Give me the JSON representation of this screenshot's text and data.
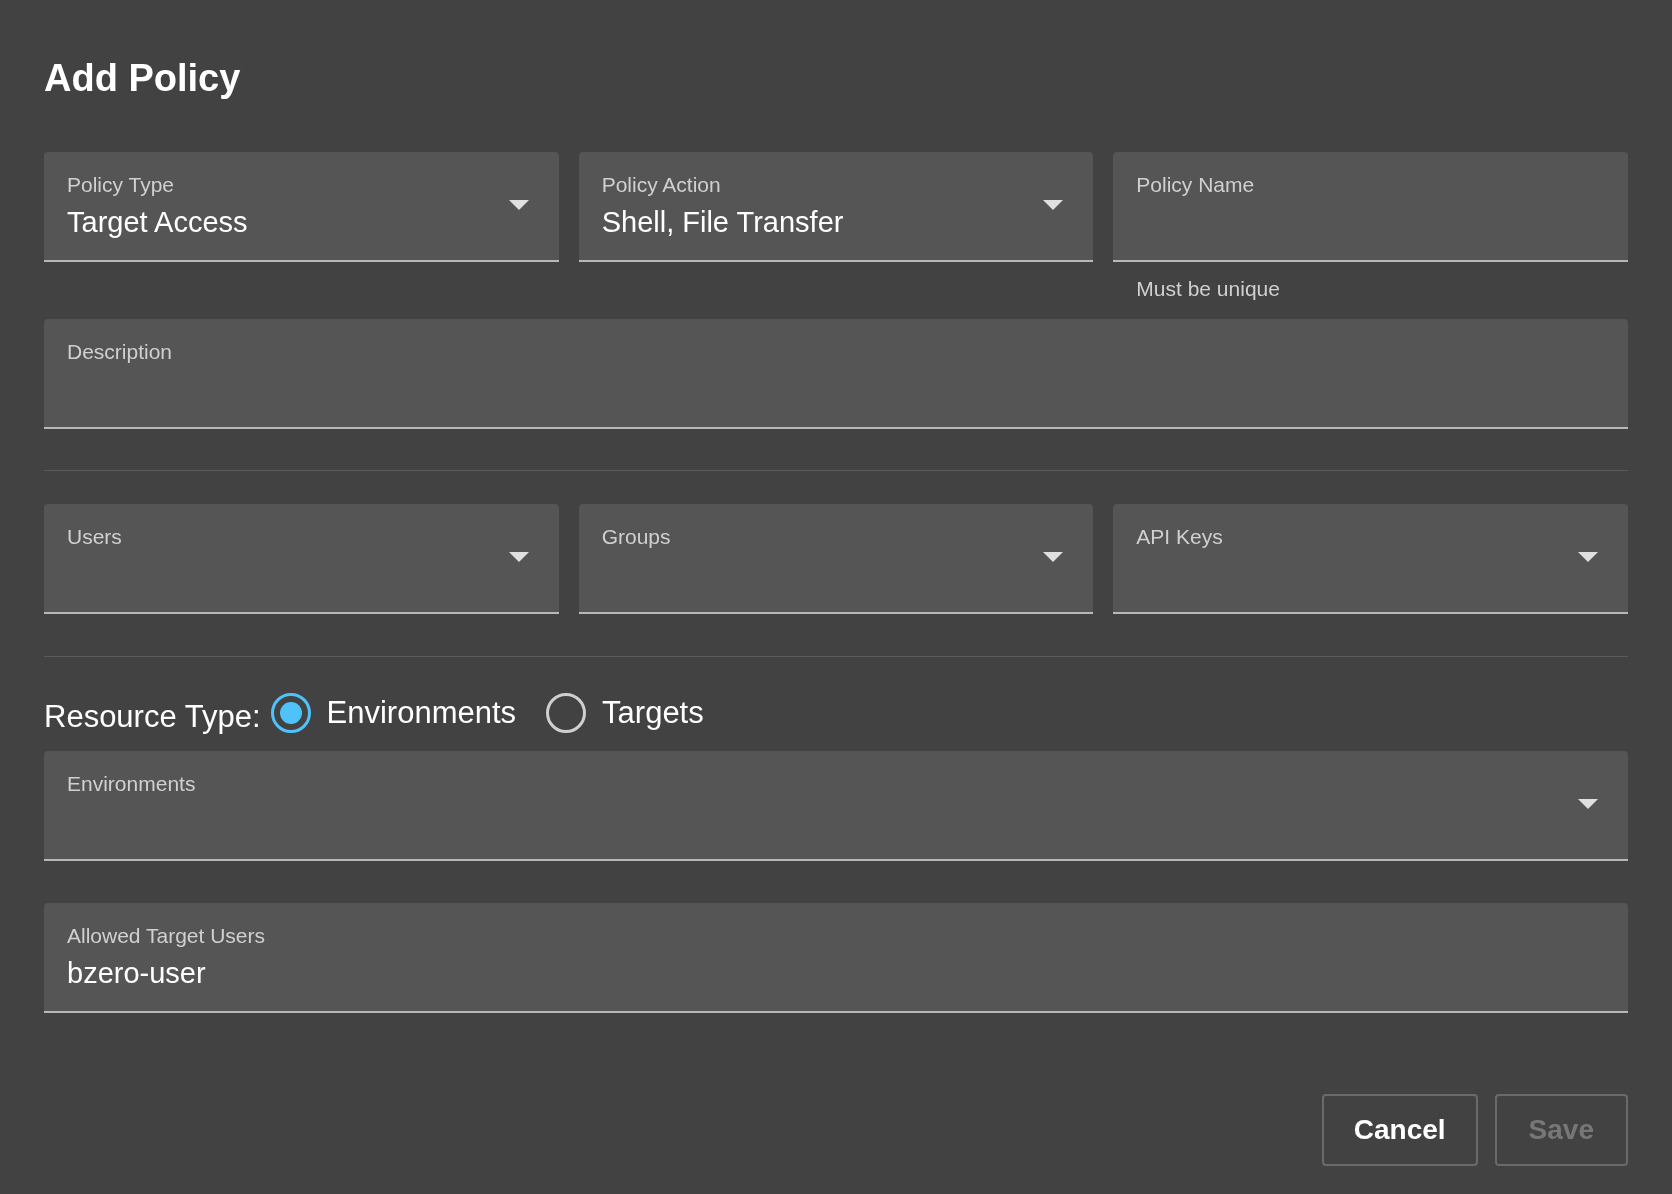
{
  "dialog": {
    "title": "Add Policy"
  },
  "top_fields": [
    {
      "kind": "select",
      "label": "Policy Type",
      "value": "Target Access"
    },
    {
      "kind": "select",
      "label": "Policy Action",
      "value": "Shell, File Transfer"
    },
    {
      "kind": "text",
      "label": "Policy Name",
      "helper": "Must be unique"
    }
  ],
  "description_field": {
    "kind": "text",
    "label": "Description"
  },
  "principal_fields": [
    {
      "kind": "select",
      "label": "Users"
    },
    {
      "kind": "select",
      "label": "Groups"
    },
    {
      "kind": "select",
      "label": "API Keys"
    }
  ],
  "resource_type": {
    "label": "Resource Type:",
    "options": [
      {
        "label": "Environments",
        "selected": true
      },
      {
        "label": "Targets",
        "selected": false
      }
    ]
  },
  "resource_field": {
    "kind": "select",
    "label": "Environments"
  },
  "target_users_field": {
    "kind": "text",
    "label": "Allowed Target Users",
    "value": "bzero-user"
  },
  "buttons": [
    {
      "label": "Cancel",
      "disabled": false
    },
    {
      "label": "Save",
      "disabled": true
    }
  ]
}
